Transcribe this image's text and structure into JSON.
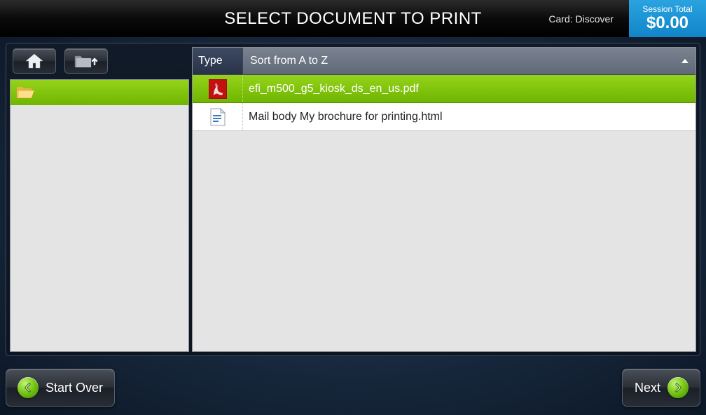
{
  "header": {
    "title": "SELECT DOCUMENT TO PRINT",
    "card_label": "Card: Discover",
    "session_label": "Session Total",
    "session_amount": "$0.00"
  },
  "sidebar": {
    "home_icon": "home-icon",
    "up_icon": "folder-up-icon",
    "current_folder": ""
  },
  "columns": {
    "type_label": "Type",
    "sort_label": "Sort from A to Z"
  },
  "files": [
    {
      "name": "efi_m500_g5_kiosk_ds_en_us.pdf",
      "type": "pdf",
      "selected": true
    },
    {
      "name": "Mail body My brochure for printing.html",
      "type": "html",
      "selected": false
    }
  ],
  "footer": {
    "start_over_label": "Start Over",
    "next_label": "Next"
  }
}
